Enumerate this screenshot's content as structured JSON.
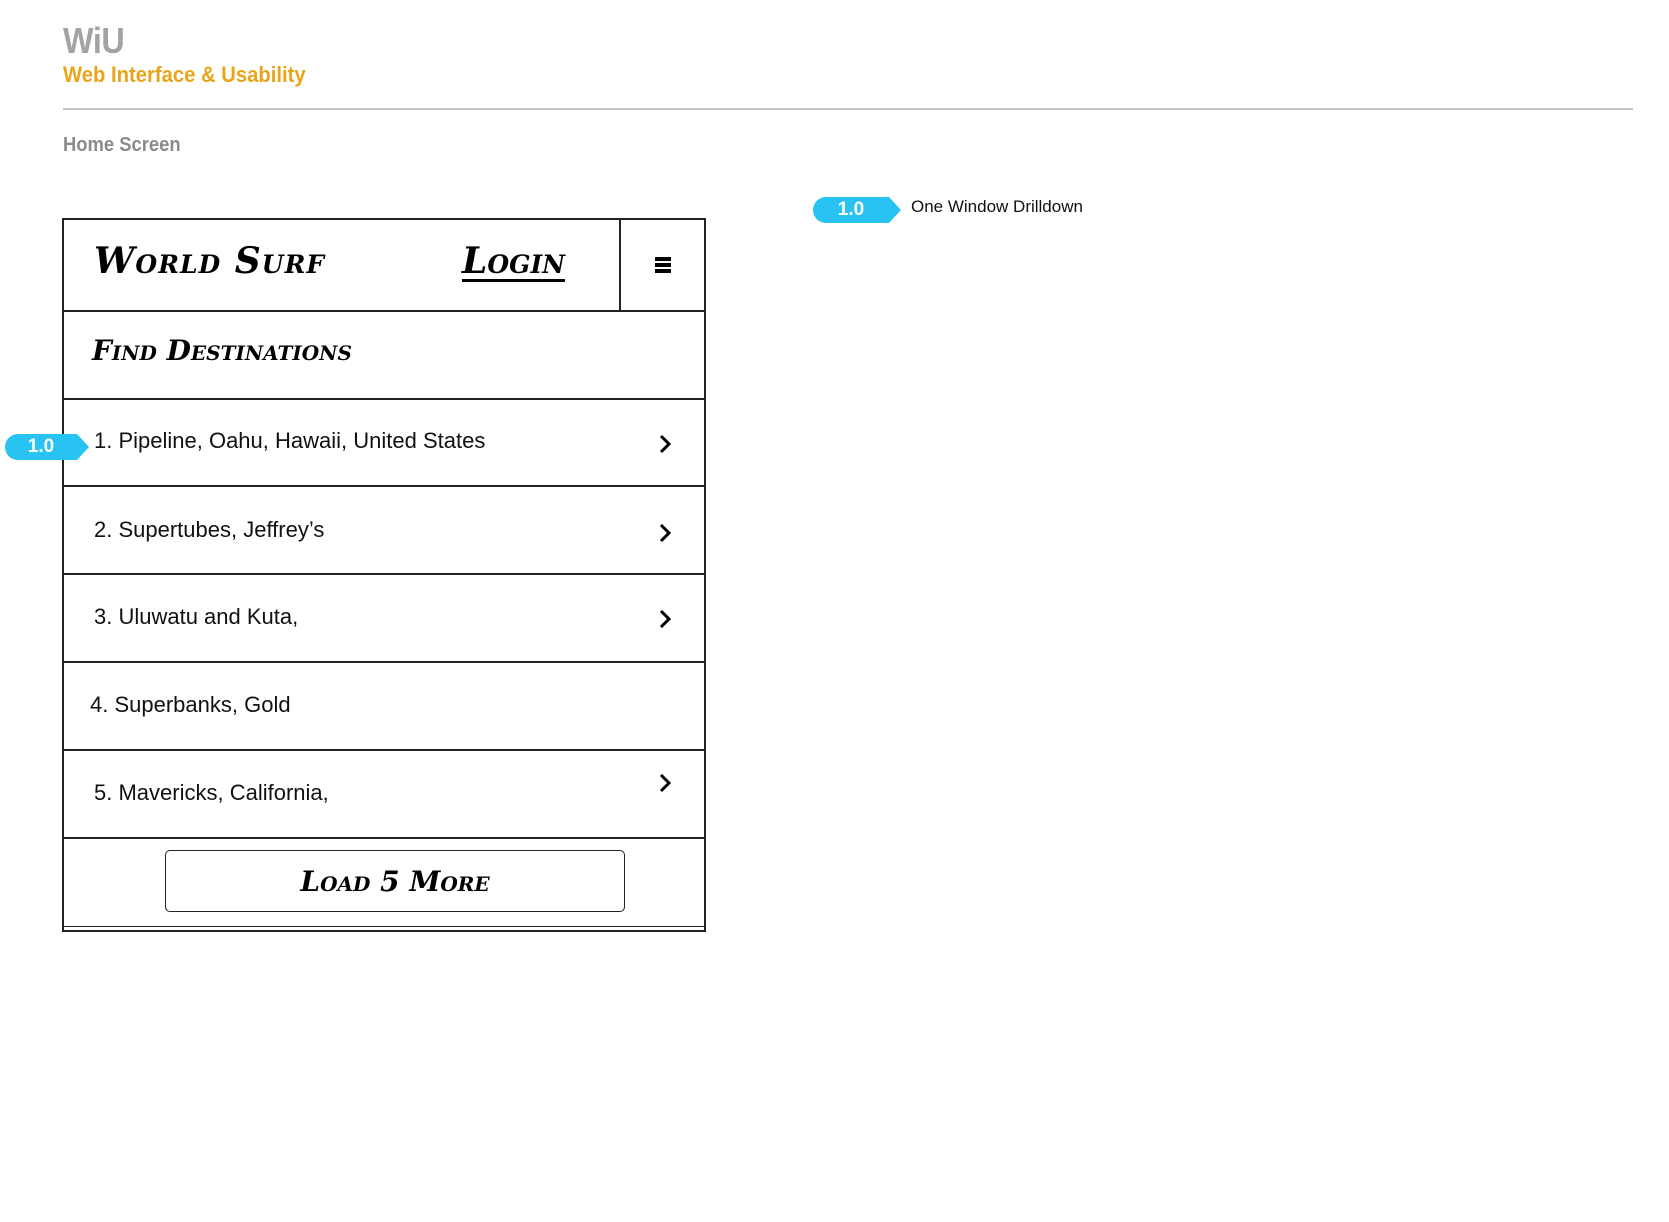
{
  "header": {
    "brand": "WiU",
    "subtitle": "Web Interface & Usability"
  },
  "page": {
    "heading": "Home Screen"
  },
  "annotations": [
    {
      "number": "1.0",
      "description": "One Window Drilldown"
    }
  ],
  "mockup": {
    "logo": "World Surf",
    "login_label": "Login",
    "menu_icon": "hamburger-icon",
    "section_title": "Find Destinations",
    "destinations": [
      {
        "label": "1. Pipeline, Oahu, Hawaii, United States",
        "has_chevron": true
      },
      {
        "label": "2. Supertubes, Jeffrey’s",
        "has_chevron": true
      },
      {
        "label": "3. Uluwatu and Kuta,",
        "has_chevron": true
      },
      {
        "label": "4. Superbanks, Gold",
        "has_chevron": false
      },
      {
        "label": "5. Mavericks, California,",
        "has_chevron": true
      }
    ],
    "load_more_label": "Load 5 More"
  },
  "colors": {
    "brand_gray": "#a3a3a3",
    "accent_orange": "#e8a51b",
    "annotation_blue": "#28c3f2"
  }
}
